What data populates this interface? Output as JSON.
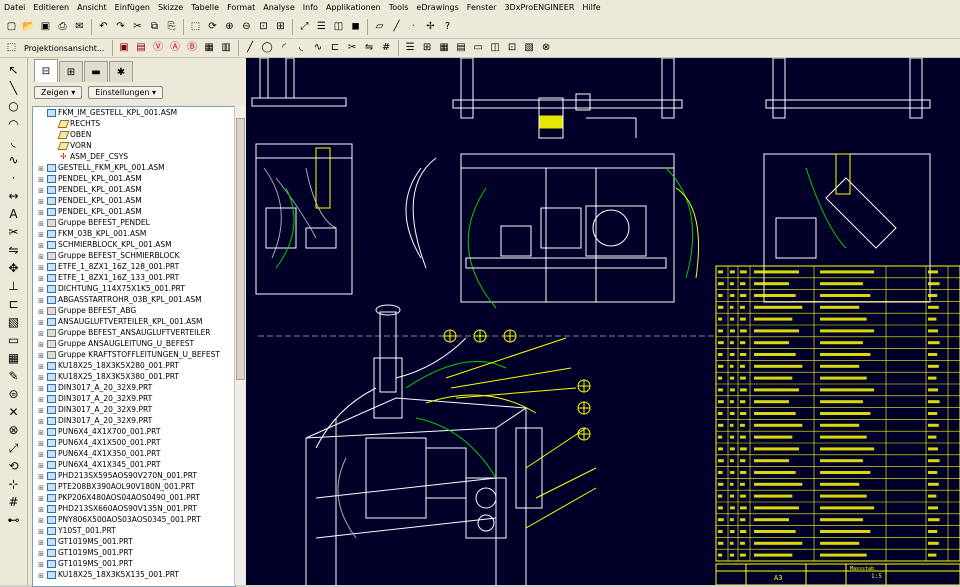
{
  "menu": [
    "Datei",
    "Editieren",
    "Ansicht",
    "Einfügen",
    "Skizze",
    "Tabelle",
    "Format",
    "Analyse",
    "Info",
    "Applikationen",
    "Tools",
    "eDrawings",
    "Fenster",
    "3DxProENGINEER",
    "Hilfe"
  ],
  "toolbar": {
    "projection_label": "Projektionsansicht...",
    "icons": [
      "new-icon",
      "open-icon",
      "save-icon",
      "print-icon",
      "email-icon",
      "undo-icon",
      "redo-icon",
      "cut-icon",
      "copy-icon",
      "paste-icon",
      "select-icon",
      "regenerate-icon",
      "zoom-in-icon",
      "zoom-out-icon",
      "refit-icon",
      "repaint-icon",
      "orient-icon",
      "view-manager-icon",
      "display-style-icon",
      "shading-icon",
      "datum-plane-icon",
      "datum-axis-icon",
      "datum-point-icon",
      "csys-icon",
      "help-icon"
    ]
  },
  "panel": {
    "show_label": "Zeigen",
    "settings_label": "Einstellungen"
  },
  "tree": [
    {
      "label": "FKM_IM_GESTELL_KPL_001.ASM",
      "icon": "asm",
      "exp": false,
      "indent": 0
    },
    {
      "label": "RECHTS",
      "icon": "plane",
      "exp": false,
      "indent": 1
    },
    {
      "label": "OBEN",
      "icon": "plane",
      "exp": false,
      "indent": 1
    },
    {
      "label": "VORN",
      "icon": "plane",
      "exp": false,
      "indent": 1
    },
    {
      "label": "ASM_DEF_CSYS",
      "icon": "csys",
      "exp": false,
      "indent": 1
    },
    {
      "label": "GESTELL_FKM_KPL_001.ASM",
      "icon": "asm",
      "exp": true,
      "indent": 0
    },
    {
      "label": "PENDEL_KPL_001.ASM",
      "icon": "asm",
      "exp": true,
      "indent": 0
    },
    {
      "label": "PENDEL_KPL_001.ASM",
      "icon": "asm",
      "exp": true,
      "indent": 0
    },
    {
      "label": "PENDEL_KPL_001.ASM",
      "icon": "asm",
      "exp": true,
      "indent": 0
    },
    {
      "label": "PENDEL_KPL_001.ASM",
      "icon": "asm",
      "exp": true,
      "indent": 0
    },
    {
      "label": "Gruppe BEFEST_PENDEL",
      "icon": "grp",
      "exp": true,
      "indent": 0
    },
    {
      "label": "FKM_03B_KPL_001.ASM",
      "icon": "asm",
      "exp": true,
      "indent": 0
    },
    {
      "label": "SCHMIERBLOCK_KPL_001.ASM",
      "icon": "asm",
      "exp": true,
      "indent": 0
    },
    {
      "label": "Gruppe BEFEST_SCHMIERBLOCK",
      "icon": "grp",
      "exp": true,
      "indent": 0
    },
    {
      "label": "ETFE_1_8ZX1_16Z_128_001.PRT",
      "icon": "prt",
      "exp": true,
      "indent": 0
    },
    {
      "label": "ETFE_1_8ZX1_16Z_133_001.PRT",
      "icon": "prt",
      "exp": true,
      "indent": 0
    },
    {
      "label": "DICHTUNG_114X75X1K5_001.PRT",
      "icon": "prt",
      "exp": true,
      "indent": 0
    },
    {
      "label": "ABGASSTARTROHR_03B_KPL_001.ASM",
      "icon": "asm",
      "exp": true,
      "indent": 0
    },
    {
      "label": "Gruppe BEFEST_ABG",
      "icon": "grp",
      "exp": true,
      "indent": 0
    },
    {
      "label": "ANSAUGLUFTVERTEILER_KPL_001.ASM",
      "icon": "asm",
      "exp": true,
      "indent": 0
    },
    {
      "label": "Gruppe BEFEST_ANSAUGLUFTVERTEILER",
      "icon": "grp",
      "exp": true,
      "indent": 0
    },
    {
      "label": "Gruppe ANSAUGLEITUNG_U_BEFEST",
      "icon": "grp",
      "exp": true,
      "indent": 0
    },
    {
      "label": "Gruppe KRAFTSTOFFLEITUNGEN_U_BEFEST",
      "icon": "grp",
      "exp": true,
      "indent": 0
    },
    {
      "label": "KU18X25_18X3K5X280_001.PRT",
      "icon": "prt",
      "exp": true,
      "indent": 0
    },
    {
      "label": "KU18X25_18X3K5X380_001.PRT",
      "icon": "prt",
      "exp": true,
      "indent": 0
    },
    {
      "label": "DIN3017_A_20_32X9.PRT",
      "icon": "prt",
      "exp": true,
      "indent": 0
    },
    {
      "label": "DIN3017_A_20_32X9.PRT",
      "icon": "prt",
      "exp": true,
      "indent": 0
    },
    {
      "label": "DIN3017_A_20_32X9.PRT",
      "icon": "prt",
      "exp": true,
      "indent": 0
    },
    {
      "label": "DIN3017_A_20_32X9.PRT",
      "icon": "prt",
      "exp": true,
      "indent": 0
    },
    {
      "label": "PUN6X4_4X1X700_001.PRT",
      "icon": "prt",
      "exp": true,
      "indent": 0
    },
    {
      "label": "PUN6X4_4X1X500_001.PRT",
      "icon": "prt",
      "exp": true,
      "indent": 0
    },
    {
      "label": "PUN6X4_4X1X350_001.PRT",
      "icon": "prt",
      "exp": true,
      "indent": 0
    },
    {
      "label": "PUN6X4_4X1X345_001.PRT",
      "icon": "prt",
      "exp": true,
      "indent": 0
    },
    {
      "label": "PHD213SX595AOS90V270N_001.PRT",
      "icon": "prt",
      "exp": true,
      "indent": 0
    },
    {
      "label": "PTE208BX390AOL90V180N_001.PRT",
      "icon": "prt",
      "exp": true,
      "indent": 0
    },
    {
      "label": "PKP206X480AOS04AOS0490_001.PRT",
      "icon": "prt",
      "exp": true,
      "indent": 0
    },
    {
      "label": "PHD213SX660AOS90V135N_001.PRT",
      "icon": "prt",
      "exp": true,
      "indent": 0
    },
    {
      "label": "PNY806X500AOS03AOS0345_001.PRT",
      "icon": "prt",
      "exp": true,
      "indent": 0
    },
    {
      "label": "Y10ST_001.PRT",
      "icon": "prt",
      "exp": true,
      "indent": 0
    },
    {
      "label": "GT1019MS_001.PRT",
      "icon": "prt",
      "exp": true,
      "indent": 0
    },
    {
      "label": "GT1019MS_001.PRT",
      "icon": "prt",
      "exp": true,
      "indent": 0
    },
    {
      "label": "GT1019MS_001.PRT",
      "icon": "prt",
      "exp": true,
      "indent": 0
    },
    {
      "label": "KU18X25_18X3K5X135_001.PRT",
      "icon": "prt",
      "exp": true,
      "indent": 0
    }
  ],
  "drawing": {
    "title_block": {
      "scale_label": "Massstab",
      "scale_value": "1:5",
      "sheet_code": "A3"
    }
  },
  "colors": {
    "canvas_bg": "#000028",
    "line_white": "#ffffff",
    "line_yellow": "#ffff00",
    "line_green": "#00c800",
    "ui_bg": "#ece9d8"
  }
}
